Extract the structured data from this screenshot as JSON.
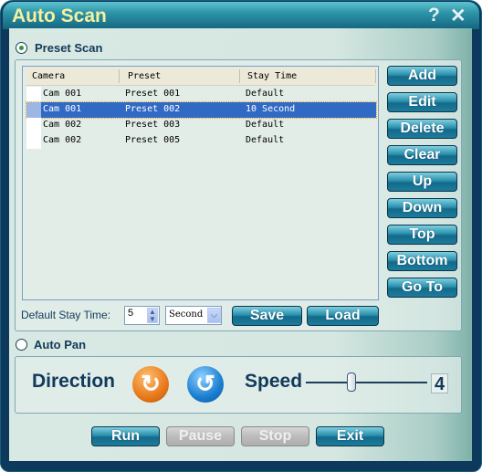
{
  "window": {
    "title": "Auto Scan",
    "help_label": "?",
    "close_label": "✕"
  },
  "preset_scan": {
    "label": "Preset Scan",
    "selected": true,
    "columns": [
      "Camera",
      "Preset",
      "Stay Time"
    ],
    "rows": [
      {
        "camera": "Cam 001",
        "preset": "Preset 001",
        "stay": "Default",
        "selected": false
      },
      {
        "camera": "Cam 001",
        "preset": "Preset 002",
        "stay": "10 Second",
        "selected": true
      },
      {
        "camera": "Cam 002",
        "preset": "Preset 003",
        "stay": "Default",
        "selected": false
      },
      {
        "camera": "Cam 002",
        "preset": "Preset 005",
        "stay": "Default",
        "selected": false
      }
    ],
    "buttons": [
      "Add",
      "Edit",
      "Delete",
      "Clear",
      "Up",
      "Down",
      "Top",
      "Bottom",
      "Go To"
    ],
    "default_stay_label": "Default Stay Time:",
    "default_stay_value": "5",
    "unit_value": "Second",
    "save_label": "Save",
    "load_label": "Load"
  },
  "auto_pan": {
    "label": "Auto Pan",
    "selected": false,
    "direction_label": "Direction",
    "ccw_icon": "rotate-counterclockwise-icon",
    "cw_icon": "rotate-clockwise-icon",
    "speed_label": "Speed",
    "speed_value": "4"
  },
  "footer": {
    "run": "Run",
    "pause": "Pause",
    "stop": "Stop",
    "exit": "Exit"
  },
  "colors": {
    "frame": "#0d3a5c",
    "accent": "#1d7c9c",
    "selection": "#316ac5",
    "title": "#f7f0a0"
  }
}
